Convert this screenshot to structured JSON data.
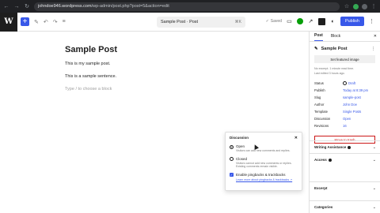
{
  "browser": {
    "url_host": "johndoe946.wordpress.com",
    "url_path": "/wp-admin/post.php?post=5&action=edit"
  },
  "toolbar": {
    "doc_title": "Sample Post · Post",
    "shortcut": "⌘K",
    "saved_label": "Saved",
    "publish_label": "Publish"
  },
  "post": {
    "title": "Sample Post",
    "paragraphs": [
      "This is my sample post.",
      "This is a sample sentence."
    ],
    "block_placeholder": "Type / to choose a block"
  },
  "discussion": {
    "title": "Discussion",
    "options": [
      {
        "label": "Open",
        "help": "Visitors can add new comments and replies.",
        "selected": true
      },
      {
        "label": "Closed",
        "help": "Visitors cannot add new comments or replies. Existing comments remain visible.",
        "selected": false
      }
    ],
    "pingbacks_label": "Enable pingbacks & trackbacks",
    "learn_more": "Learn more about pingbacks & trackbacks ↗"
  },
  "sidebar": {
    "tabs": [
      "Post",
      "Block"
    ],
    "post_title": "Sample Post",
    "featured_button": "Set featured image",
    "meta_lines": [
      "No excerpt. 1 minute read time.",
      "Last edited 3 hours ago."
    ],
    "rows": [
      {
        "key": "Status",
        "value": "Draft"
      },
      {
        "key": "Publish",
        "value": "Today at 8:39 pm"
      },
      {
        "key": "Slug",
        "value": "sample-post"
      },
      {
        "key": "Author",
        "value": "John Doe"
      },
      {
        "key": "Template",
        "value": "Single Posts"
      },
      {
        "key": "Discussion",
        "value": "Open"
      },
      {
        "key": "Revisions",
        "value": "16"
      }
    ],
    "trash_label": "Move to trash",
    "panels": [
      "Writing Assistance",
      "Access",
      "Excerpt",
      "Categories"
    ]
  },
  "colors": {
    "accent": "#3858e9",
    "danger": "#cc1818",
    "jetpack": "#069e08"
  }
}
